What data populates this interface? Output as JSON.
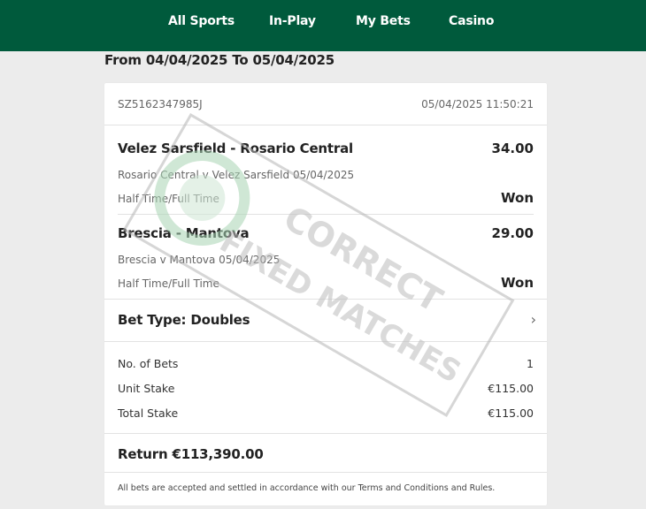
{
  "nav": {
    "items": [
      "All Sports",
      "In-Play",
      "My Bets",
      "Casino"
    ]
  },
  "date_range": "From 04/04/2025 To 05/04/2025",
  "bet": {
    "reference": "SZ5162347985J",
    "timestamp": "05/04/2025 11:50:21",
    "selections": [
      {
        "title": "Velez Sarsfield - Rosario Central",
        "odds": "34.00",
        "event": "Rosario Central v Velez Sarsfield 05/04/2025",
        "market": "Half Time/Full Time",
        "result": "Won"
      },
      {
        "title": "Brescia - Mantova",
        "odds": "29.00",
        "event": "Brescia v Mantova 05/04/2025",
        "market": "Half Time/Full Time",
        "result": "Won"
      }
    ],
    "bet_type": "Bet Type: Doubles",
    "stats": [
      {
        "label": "No. of Bets",
        "value": "1"
      },
      {
        "label": "Unit Stake",
        "value": "€115.00"
      },
      {
        "label": "Total Stake",
        "value": "€115.00"
      }
    ],
    "return": "Return €113,390.00",
    "terms": "All bets are accepted and settled in accordance with our Terms and Conditions and Rules."
  },
  "watermark": {
    "line1": "CORRECT",
    "line2": "FIXED MATCHES",
    "color": "#bdbdbd"
  },
  "colors": {
    "brand": "#005a3c",
    "background": "#ececec"
  }
}
